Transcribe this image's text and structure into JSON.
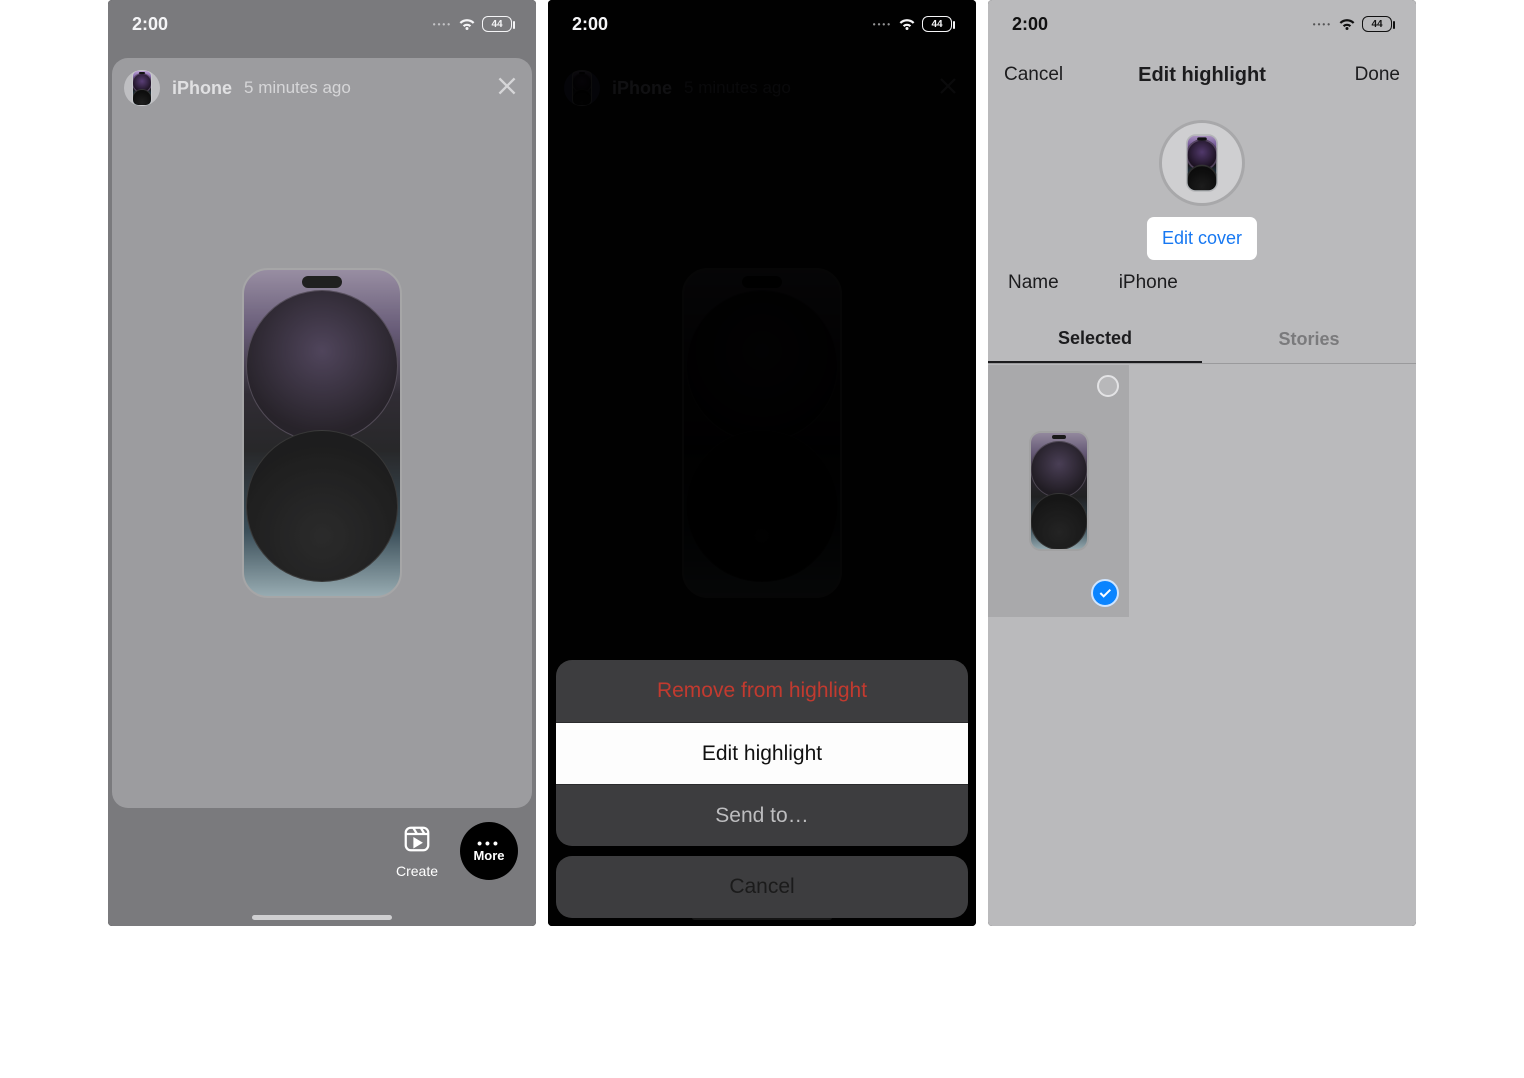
{
  "status": {
    "time": "2:00",
    "battery": "44"
  },
  "screen1": {
    "highlight_name": "iPhone",
    "timestamp": "5 minutes ago",
    "create_label": "Create",
    "more_label": "More"
  },
  "screen2": {
    "highlight_name": "iPhone",
    "timestamp": "5 minutes ago",
    "menu": {
      "remove": "Remove from highlight",
      "edit": "Edit highlight",
      "send": "Send to…",
      "cancel": "Cancel"
    }
  },
  "screen3": {
    "nav": {
      "cancel": "Cancel",
      "title": "Edit highlight",
      "done": "Done"
    },
    "edit_cover": "Edit cover",
    "name_label": "Name",
    "name_value": "iPhone",
    "tabs": {
      "selected": "Selected",
      "stories": "Stories"
    }
  }
}
